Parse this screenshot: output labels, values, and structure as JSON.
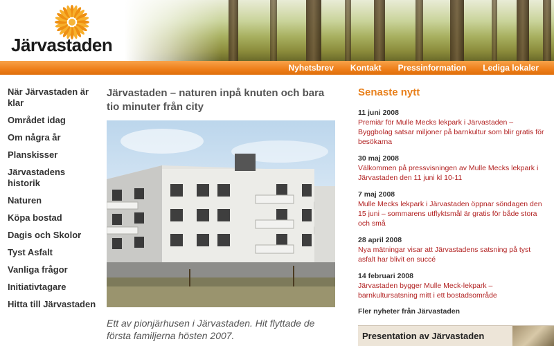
{
  "brand": {
    "name": "Järvastaden"
  },
  "nav": {
    "items": [
      {
        "label": "Nyhetsbrev"
      },
      {
        "label": "Kontakt"
      },
      {
        "label": "Pressinformation"
      },
      {
        "label": "Lediga lokaler"
      }
    ]
  },
  "sidebar": {
    "items": [
      {
        "label": "När Järvastaden är klar"
      },
      {
        "label": "Området idag"
      },
      {
        "label": "Om några år"
      },
      {
        "label": "Planskisser"
      },
      {
        "label": "Järvastadens historik"
      },
      {
        "label": "Naturen"
      },
      {
        "label": "Köpa bostad"
      },
      {
        "label": "Dagis och Skolor"
      },
      {
        "label": "Tyst Asfalt"
      },
      {
        "label": "Vanliga frågor"
      },
      {
        "label": "Initiativtagare"
      },
      {
        "label": "Hitta till Järvastaden"
      }
    ]
  },
  "main": {
    "title": "Järvastaden – naturen inpå knuten och bara tio minuter från city",
    "caption": "Ett av pionjärhusen i Järvastaden. Hit flyttade de första familjerna hösten 2007."
  },
  "news": {
    "heading": "Senaste nytt",
    "items": [
      {
        "date": "11 juni 2008",
        "text": "Premiär för Mulle Mecks lekpark i Järvastaden – Byggbolag satsar miljoner på barnkultur som blir gratis för besökarna"
      },
      {
        "date": "30 maj 2008",
        "text": "Välkommen på pressvisningen av Mulle Mecks lekpark i Järvastaden den 11 juni kl 10-11"
      },
      {
        "date": "7 maj 2008",
        "text": "Mulle Mecks lekpark i Järvastaden öppnar söndagen den 15 juni – sommarens utflyktsmål är gratis för både stora och små"
      },
      {
        "date": "28 april 2008",
        "text": "Nya mätningar visar att Järvastadens satsning på tyst asfalt har blivit en succé"
      },
      {
        "date": "14 februari 2008",
        "text": "Järvastaden bygger Mulle Meck-lekpark – barnkultursatsning mitt i ett bostadsområde"
      }
    ],
    "more_label": "Fler nyheter från Järvastaden"
  },
  "promo": {
    "label": "Presentation av Järvastaden"
  },
  "colors": {
    "accent": "#ee7f1a",
    "news_link": "#b22222",
    "heading_orange": "#e8801c"
  },
  "icons": {
    "logo": "sun-logo-icon"
  }
}
